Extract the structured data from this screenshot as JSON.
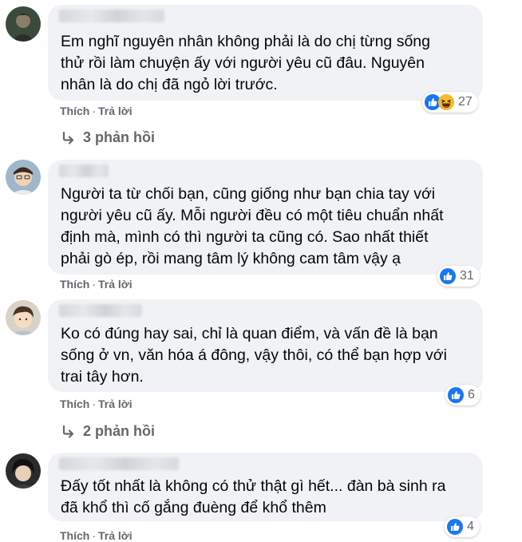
{
  "comments": [
    {
      "text_lines": [
        "Em nghĩ nguyên nhân không phải là do chị từng sống",
        "thử rồi làm chuyện ấy với người yêu cũ đâu. Nguyên",
        "nhân là do chị đã ngỏ lời trước."
      ],
      "like_label": "Thích",
      "reply_label": "Trả lời",
      "reactions": [
        "like",
        "haha"
      ],
      "reaction_count": "27",
      "replies_label": "3 phản hồi"
    },
    {
      "text_lines": [
        "Người ta từ chối bạn, cũng giống như bạn chia tay với",
        "người yêu cũ ấy. Mỗi người đều có một tiêu chuẩn nhất",
        "định mà, mình có thì người ta cũng có. Sao nhất thiết",
        "phải gò ép, rồi mang tâm lý không cam tâm vậy ạ"
      ],
      "like_label": "Thích",
      "reply_label": "Trả lời",
      "reactions": [
        "like"
      ],
      "reaction_count": "31"
    },
    {
      "text_lines": [
        "Ko có đúng hay sai, chỉ là quan điểm, và vấn đề là bạn",
        "sống ở vn, văn hóa á đông, vậy thôi, có thể bạn hợp với",
        "trai tây hơn."
      ],
      "like_label": "Thích",
      "reply_label": "Trả lời",
      "reactions": [
        "like"
      ],
      "reaction_count": "6",
      "replies_label": "2 phản hồi"
    },
    {
      "text_lines": [
        "Đấy tốt nhất là không có thử thật gì hết... đàn bà sinh ra",
        "đã khổ thì cố gắng đuèng để khổ thêm"
      ],
      "like_label": "Thích",
      "reply_label": "Trả lời",
      "reactions": [
        "like"
      ],
      "reaction_count": "4"
    }
  ],
  "separator": "·",
  "colors": {
    "bubble": "#f0f2f5",
    "meta_text": "#65676b",
    "like_blue": "#1877f2",
    "haha_yellow": "#f7b928"
  },
  "icons": {
    "like": "like-reaction-icon",
    "haha": "haha-reaction-icon",
    "reply_arrow": "reply-arrow-icon"
  }
}
